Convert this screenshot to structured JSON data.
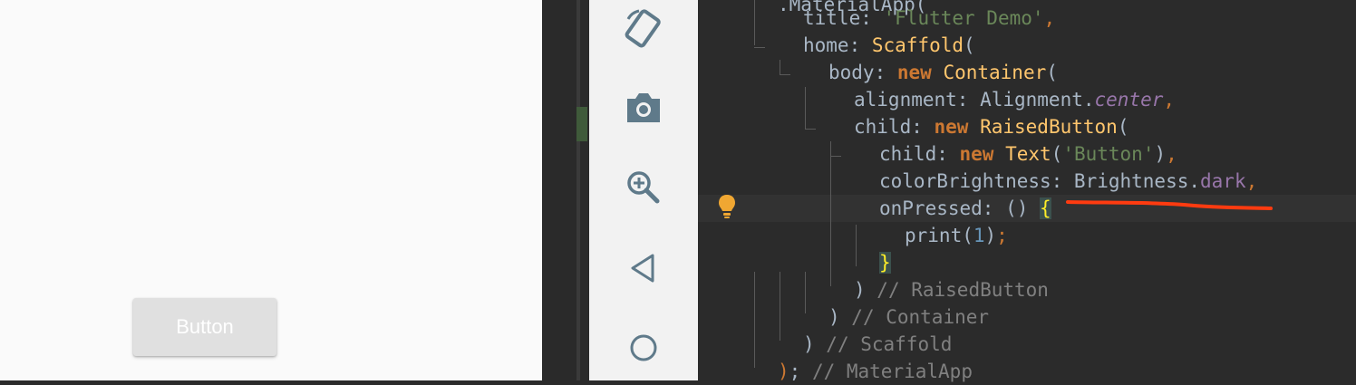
{
  "emulator": {
    "button_label": "Button"
  },
  "toolbar": {
    "icons": [
      "rotate-icon",
      "camera-icon",
      "zoom-in-icon",
      "back-icon",
      "home-icon"
    ]
  },
  "editor": {
    "lines": [
      {
        "id": "l0",
        "tokens": [
          [
            "",
            "."
          ],
          [
            "plain",
            "MaterialApp("
          ]
        ]
      },
      {
        "id": "l1",
        "tokens": [
          [
            "plain",
            "title: "
          ],
          [
            "str",
            "'Flutter Demo'"
          ],
          [
            "punc",
            ","
          ]
        ]
      },
      {
        "id": "l2",
        "tokens": [
          [
            "plain",
            "home: "
          ],
          [
            "cls",
            "Scaffold"
          ],
          [
            "plain",
            "("
          ]
        ]
      },
      {
        "id": "l3",
        "tokens": [
          [
            "plain",
            "body: "
          ],
          [
            "kw",
            "new "
          ],
          [
            "cls",
            "Container"
          ],
          [
            "plain",
            "("
          ]
        ]
      },
      {
        "id": "l4",
        "tokens": [
          [
            "plain",
            "alignment: Alignment."
          ],
          [
            "field",
            "center"
          ],
          [
            "punc",
            ","
          ]
        ]
      },
      {
        "id": "l5",
        "tokens": [
          [
            "plain",
            "child: "
          ],
          [
            "kw",
            "new "
          ],
          [
            "cls",
            "RaisedButton"
          ],
          [
            "plain",
            "("
          ]
        ]
      },
      {
        "id": "l6",
        "tokens": [
          [
            "plain",
            "child: "
          ],
          [
            "kw",
            "new "
          ],
          [
            "cls",
            "Text"
          ],
          [
            "plain",
            "("
          ],
          [
            "str",
            "'Button'"
          ],
          [
            "plain",
            ")"
          ],
          [
            "punc",
            ","
          ]
        ]
      },
      {
        "id": "l7",
        "tokens": [
          [
            "plain",
            "colorBrightness: Brightness."
          ],
          [
            "fieldn",
            "dark"
          ],
          [
            "punc",
            ","
          ]
        ]
      },
      {
        "id": "l8",
        "tokens": [
          [
            "plain",
            "onPressed: () "
          ],
          [
            "brace",
            "{"
          ]
        ]
      },
      {
        "id": "l9",
        "tokens": [
          [
            "plain",
            "print("
          ],
          [
            "num",
            "1"
          ],
          [
            "plain",
            ")"
          ],
          [
            "punc",
            ";"
          ]
        ]
      },
      {
        "id": "l10",
        "tokens": [
          [
            "brace",
            "}"
          ]
        ]
      },
      {
        "id": "l11",
        "tokens": [
          [
            "plain",
            ") "
          ],
          [
            "cmt",
            "// RaisedButton"
          ]
        ]
      },
      {
        "id": "l12",
        "tokens": [
          [
            "plain",
            ") "
          ],
          [
            "cmt",
            "// Container"
          ]
        ]
      },
      {
        "id": "l13",
        "tokens": [
          [
            "plain",
            ") "
          ],
          [
            "cmt",
            "// Scaffold"
          ]
        ]
      },
      {
        "id": "l14",
        "tokens": [
          [
            "punc",
            ")"
          ],
          [
            "plain",
            "; "
          ],
          [
            "cmt",
            "// MaterialApp"
          ]
        ]
      }
    ]
  },
  "colors": {
    "annotation_underline": "#ff3b10",
    "bulb": "#f0a732"
  }
}
